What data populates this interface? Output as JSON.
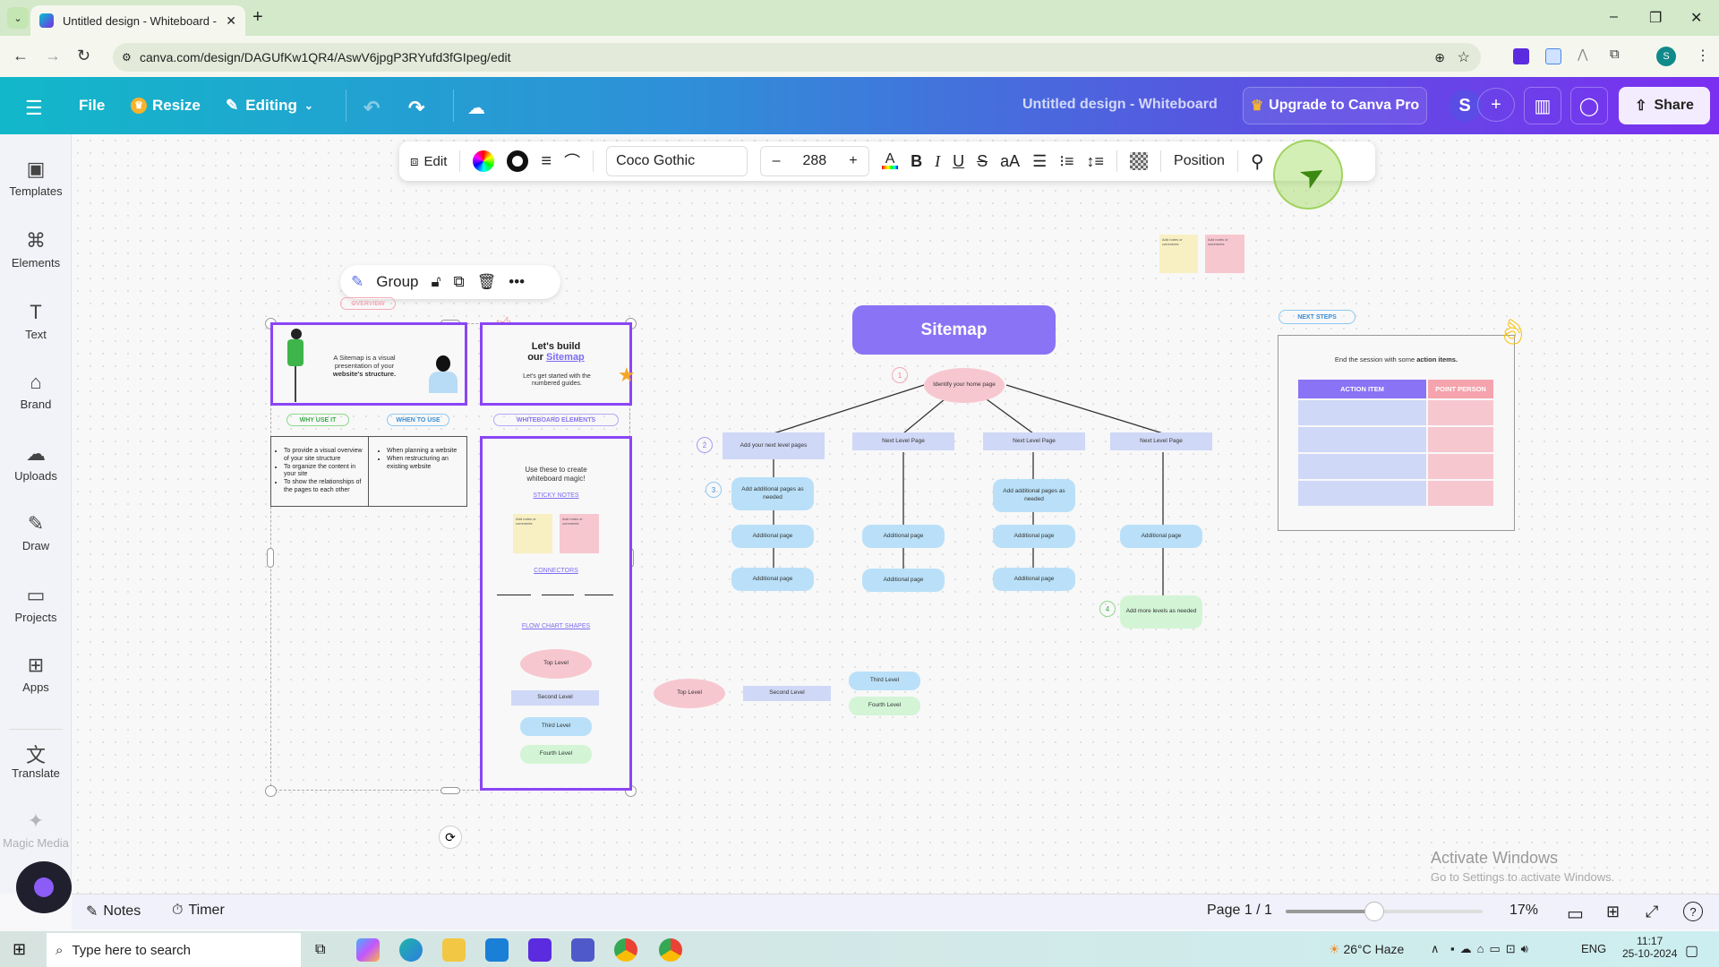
{
  "browser": {
    "tab_title": "Untitled design - Whiteboard - ",
    "url": "canva.com/design/DAGUfKw1QR4/AswV6jpgP3RYufd3fGIpeg/edit",
    "profile_initial": "S"
  },
  "header": {
    "file": "File",
    "resize": "Resize",
    "editing": "Editing",
    "doc_title": "Untitled design - Whiteboard",
    "upgrade": "Upgrade to Canva Pro",
    "avatar": "S",
    "share": "Share"
  },
  "sidebar": {
    "items": [
      {
        "label": "Templates",
        "icon": "▣"
      },
      {
        "label": "Elements",
        "icon": "⌘"
      },
      {
        "label": "Text",
        "icon": "T"
      },
      {
        "label": "Brand",
        "icon": "⌂"
      },
      {
        "label": "Uploads",
        "icon": "☁"
      },
      {
        "label": "Draw",
        "icon": "✎"
      },
      {
        "label": "Projects",
        "icon": "▭"
      },
      {
        "label": "Apps",
        "icon": "⊞"
      },
      {
        "label": "Translate",
        "icon": "文"
      },
      {
        "label": "Magic Media",
        "icon": "✦"
      }
    ]
  },
  "toolbar": {
    "edit": "Edit",
    "font": "Coco Gothic",
    "size": "288",
    "minus": "–",
    "plus": "+",
    "bold": "B",
    "italic": "I",
    "underline": "U",
    "strike": "S",
    "case": "aA",
    "position": "Position"
  },
  "group_toolbar": {
    "label": "Group"
  },
  "board": {
    "overview": "OVERVIEW",
    "intro_text": [
      "A Sitemap is a visual",
      "presentation of your",
      "website's structure."
    ],
    "lets_build": "Let's build",
    "our": "our ",
    "sitemap_link": "Sitemap",
    "lets_get": "Let's get started with the numbered guides.",
    "why_use": "WHY USE IT",
    "when_use": "WHEN TO USE",
    "wb_elements": "WHITEBOARD ELEMENTS",
    "why_list": [
      "To provide a visual overview of your site structure",
      "To organize the content in your site",
      "To show the relationships of the pages to each other"
    ],
    "when_list": [
      "When planning a website",
      "When restructuring an existing website"
    ],
    "use_these": "Use these to create whiteboard magic!",
    "sticky_notes": "STICKY NOTES",
    "sticky_text": "Add notes or comments",
    "connectors": "CONNECTORS",
    "flow_shapes": "FLOW CHART SHAPES",
    "levels": [
      "Top Level",
      "Second Level",
      "Third Level",
      "Fourth Level"
    ],
    "sitemap_title": "Sitemap",
    "home": "Identify your home page",
    "add_next": "Add your next level pages",
    "next_level": "Next Level Page",
    "add_additional": "Add additional pages as needed",
    "additional": "Additional page",
    "add_more": "Add more levels as needed",
    "nums": [
      "1",
      "2",
      "3",
      "4"
    ],
    "next_steps": "NEXT STEPS",
    "end_session_a": "End the session with some ",
    "end_session_b": "action items.",
    "table_headers": [
      "ACTION ITEM",
      "POINT PERSON"
    ]
  },
  "bottom": {
    "notes": "Notes",
    "timer": "Timer",
    "page": "Page 1 / 1",
    "zoom": "17%",
    "zoom_level_fraction": 0.45
  },
  "watermark": {
    "line1": "Activate Windows",
    "line2": "Go to Settings to activate Windows."
  },
  "taskbar": {
    "search": "Type here to search",
    "weather": "26°C  Haze",
    "lang": "ENG",
    "time": "11:17",
    "date": "25-10-2024"
  }
}
